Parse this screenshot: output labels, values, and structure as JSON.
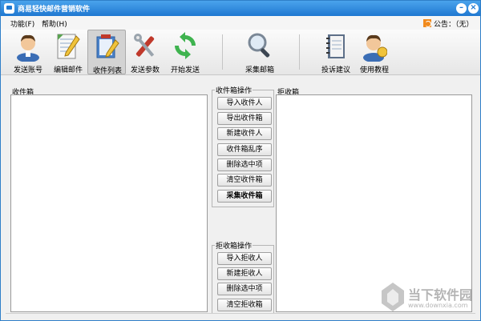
{
  "window": {
    "title": "商易轻快邮件营销软件",
    "minimize_label": "–",
    "close_label": "×"
  },
  "menu": {
    "items": [
      {
        "label": "功能(F)"
      },
      {
        "label": "帮助(H)"
      }
    ],
    "notice": "公告：（无）"
  },
  "toolbar": {
    "items": [
      {
        "label": "发送账号",
        "icon": "user-icon"
      },
      {
        "label": "编辑邮件",
        "icon": "edit-document-icon"
      },
      {
        "label": "收件列表",
        "icon": "recipient-list-icon"
      },
      {
        "label": "发送参数",
        "icon": "tools-icon"
      },
      {
        "label": "开始发送",
        "icon": "refresh-icon"
      },
      {
        "label": "采集邮箱",
        "icon": "magnifier-icon"
      },
      {
        "label": "投诉建议",
        "icon": "notebook-icon"
      },
      {
        "label": "使用教程",
        "icon": "help-user-icon"
      }
    ],
    "active_index": 2
  },
  "inbox": {
    "title": "收件箱"
  },
  "rejectbox": {
    "title": "拒收箱"
  },
  "inbox_ops": {
    "title": "收件箱操作",
    "buttons": [
      "导入收件人",
      "导出收件箱",
      "新建收件人",
      "收件箱乱序",
      "删除选中项",
      "清空收件箱",
      "采集收件箱"
    ]
  },
  "reject_ops": {
    "title": "拒收箱操作",
    "buttons": [
      "导入拒收人",
      "新建拒收人",
      "删除选中项",
      "清空拒收箱"
    ]
  },
  "watermark": {
    "text": "当下软件园",
    "url": "www.downxia.com"
  },
  "colors": {
    "titlebar": "#1f78d1",
    "notice_icon": "#f18a1c"
  }
}
